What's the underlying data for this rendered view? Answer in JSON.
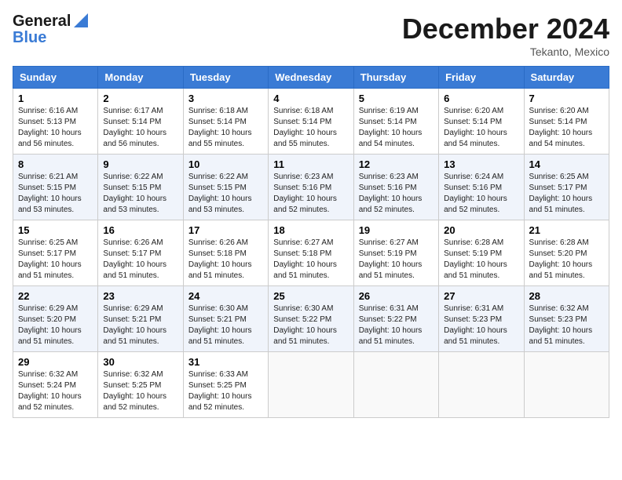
{
  "header": {
    "logo_line1": "General",
    "logo_line2": "Blue",
    "month": "December 2024",
    "location": "Tekanto, Mexico"
  },
  "weekdays": [
    "Sunday",
    "Monday",
    "Tuesday",
    "Wednesday",
    "Thursday",
    "Friday",
    "Saturday"
  ],
  "weeks": [
    [
      {
        "day": "1",
        "info": "Sunrise: 6:16 AM\nSunset: 5:13 PM\nDaylight: 10 hours\nand 56 minutes."
      },
      {
        "day": "2",
        "info": "Sunrise: 6:17 AM\nSunset: 5:14 PM\nDaylight: 10 hours\nand 56 minutes."
      },
      {
        "day": "3",
        "info": "Sunrise: 6:18 AM\nSunset: 5:14 PM\nDaylight: 10 hours\nand 55 minutes."
      },
      {
        "day": "4",
        "info": "Sunrise: 6:18 AM\nSunset: 5:14 PM\nDaylight: 10 hours\nand 55 minutes."
      },
      {
        "day": "5",
        "info": "Sunrise: 6:19 AM\nSunset: 5:14 PM\nDaylight: 10 hours\nand 54 minutes."
      },
      {
        "day": "6",
        "info": "Sunrise: 6:20 AM\nSunset: 5:14 PM\nDaylight: 10 hours\nand 54 minutes."
      },
      {
        "day": "7",
        "info": "Sunrise: 6:20 AM\nSunset: 5:14 PM\nDaylight: 10 hours\nand 54 minutes."
      }
    ],
    [
      {
        "day": "8",
        "info": "Sunrise: 6:21 AM\nSunset: 5:15 PM\nDaylight: 10 hours\nand 53 minutes."
      },
      {
        "day": "9",
        "info": "Sunrise: 6:22 AM\nSunset: 5:15 PM\nDaylight: 10 hours\nand 53 minutes."
      },
      {
        "day": "10",
        "info": "Sunrise: 6:22 AM\nSunset: 5:15 PM\nDaylight: 10 hours\nand 53 minutes."
      },
      {
        "day": "11",
        "info": "Sunrise: 6:23 AM\nSunset: 5:16 PM\nDaylight: 10 hours\nand 52 minutes."
      },
      {
        "day": "12",
        "info": "Sunrise: 6:23 AM\nSunset: 5:16 PM\nDaylight: 10 hours\nand 52 minutes."
      },
      {
        "day": "13",
        "info": "Sunrise: 6:24 AM\nSunset: 5:16 PM\nDaylight: 10 hours\nand 52 minutes."
      },
      {
        "day": "14",
        "info": "Sunrise: 6:25 AM\nSunset: 5:17 PM\nDaylight: 10 hours\nand 51 minutes."
      }
    ],
    [
      {
        "day": "15",
        "info": "Sunrise: 6:25 AM\nSunset: 5:17 PM\nDaylight: 10 hours\nand 51 minutes."
      },
      {
        "day": "16",
        "info": "Sunrise: 6:26 AM\nSunset: 5:17 PM\nDaylight: 10 hours\nand 51 minutes."
      },
      {
        "day": "17",
        "info": "Sunrise: 6:26 AM\nSunset: 5:18 PM\nDaylight: 10 hours\nand 51 minutes."
      },
      {
        "day": "18",
        "info": "Sunrise: 6:27 AM\nSunset: 5:18 PM\nDaylight: 10 hours\nand 51 minutes."
      },
      {
        "day": "19",
        "info": "Sunrise: 6:27 AM\nSunset: 5:19 PM\nDaylight: 10 hours\nand 51 minutes."
      },
      {
        "day": "20",
        "info": "Sunrise: 6:28 AM\nSunset: 5:19 PM\nDaylight: 10 hours\nand 51 minutes."
      },
      {
        "day": "21",
        "info": "Sunrise: 6:28 AM\nSunset: 5:20 PM\nDaylight: 10 hours\nand 51 minutes."
      }
    ],
    [
      {
        "day": "22",
        "info": "Sunrise: 6:29 AM\nSunset: 5:20 PM\nDaylight: 10 hours\nand 51 minutes."
      },
      {
        "day": "23",
        "info": "Sunrise: 6:29 AM\nSunset: 5:21 PM\nDaylight: 10 hours\nand 51 minutes."
      },
      {
        "day": "24",
        "info": "Sunrise: 6:30 AM\nSunset: 5:21 PM\nDaylight: 10 hours\nand 51 minutes."
      },
      {
        "day": "25",
        "info": "Sunrise: 6:30 AM\nSunset: 5:22 PM\nDaylight: 10 hours\nand 51 minutes."
      },
      {
        "day": "26",
        "info": "Sunrise: 6:31 AM\nSunset: 5:22 PM\nDaylight: 10 hours\nand 51 minutes."
      },
      {
        "day": "27",
        "info": "Sunrise: 6:31 AM\nSunset: 5:23 PM\nDaylight: 10 hours\nand 51 minutes."
      },
      {
        "day": "28",
        "info": "Sunrise: 6:32 AM\nSunset: 5:23 PM\nDaylight: 10 hours\nand 51 minutes."
      }
    ],
    [
      {
        "day": "29",
        "info": "Sunrise: 6:32 AM\nSunset: 5:24 PM\nDaylight: 10 hours\nand 52 minutes."
      },
      {
        "day": "30",
        "info": "Sunrise: 6:32 AM\nSunset: 5:25 PM\nDaylight: 10 hours\nand 52 minutes."
      },
      {
        "day": "31",
        "info": "Sunrise: 6:33 AM\nSunset: 5:25 PM\nDaylight: 10 hours\nand 52 minutes."
      },
      {
        "day": "",
        "info": ""
      },
      {
        "day": "",
        "info": ""
      },
      {
        "day": "",
        "info": ""
      },
      {
        "day": "",
        "info": ""
      }
    ]
  ]
}
